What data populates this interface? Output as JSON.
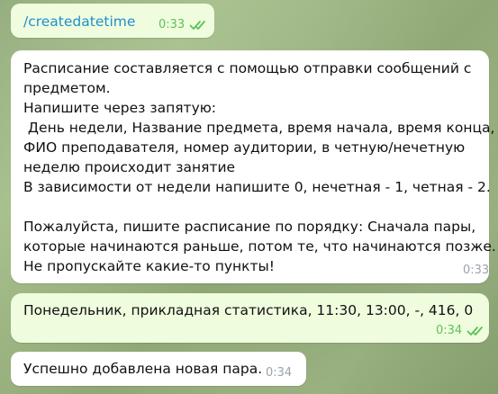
{
  "colors": {
    "outgoing_bubble": "#effdde",
    "incoming_bubble": "#ffffff",
    "outgoing_meta": "#5fbf5a",
    "incoming_meta": "#9aa3ab",
    "command_link": "#1e8fcf"
  },
  "messages": [
    {
      "direction": "outgoing",
      "text": "/createdatetime",
      "time": "0:33",
      "status_icon": "double-check-icon"
    },
    {
      "direction": "incoming",
      "lines": [
        "Расписание составляется с помощью отправки сообщений с",
        "предметом.",
        "Напишите через запятую:",
        " День недели, Название предмета, время начала, время конца,",
        "ФИО преподавателя, номер аудитории, в четную/нечетную",
        "неделю происходит занятие",
        "В зависимости от недели напишите 0, нечетная - 1, четная - 2.",
        "",
        "Пожалуйста, пишите расписание по порядку: Сначала пары,",
        "которые начинаются раньше, потом те, что начинаются позже.",
        "Не пропускайте какие-то пункты!"
      ],
      "time": "0:33"
    },
    {
      "direction": "outgoing",
      "text": "Понедельник, прикладная статистика, 11:30, 13:00, -, 416, 0",
      "time": "0:34",
      "status_icon": "double-check-icon"
    },
    {
      "direction": "incoming",
      "text": "Успешно добавлена новая пара.",
      "time": "0:34"
    }
  ]
}
